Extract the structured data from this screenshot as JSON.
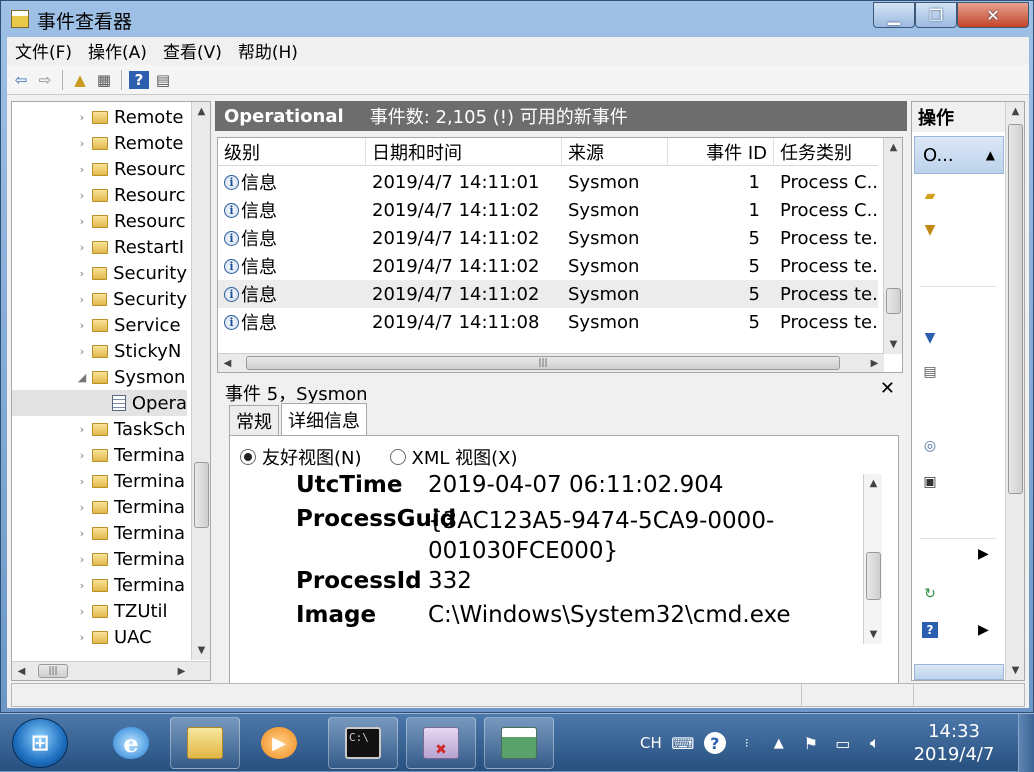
{
  "window": {
    "title": "事件查看器"
  },
  "menu": {
    "items": [
      "文件(F)",
      "操作(A)",
      "查看(V)",
      "帮助(H)"
    ]
  },
  "tree": {
    "items": [
      {
        "label": "Remote"
      },
      {
        "label": "Remote"
      },
      {
        "label": "Resourc"
      },
      {
        "label": "Resourc"
      },
      {
        "label": "Resourc"
      },
      {
        "label": "RestartI"
      },
      {
        "label": "Security"
      },
      {
        "label": "Security"
      },
      {
        "label": "Service"
      },
      {
        "label": "StickyN"
      },
      {
        "label": "Sysmon"
      },
      {
        "label": "Opera"
      },
      {
        "label": "TaskSch"
      },
      {
        "label": "Termina"
      },
      {
        "label": "Termina"
      },
      {
        "label": "Termina"
      },
      {
        "label": "Termina"
      },
      {
        "label": "Termina"
      },
      {
        "label": "Termina"
      },
      {
        "label": "TZUtil"
      },
      {
        "label": "UAC"
      }
    ]
  },
  "log": {
    "title": "Operational",
    "count_text": "事件数: 2,105 (!) 可用的新事件"
  },
  "grid": {
    "headers": [
      "级别",
      "日期和时间",
      "来源",
      "事件 ID",
      "任务类别"
    ],
    "rows": [
      {
        "level": "信息",
        "datetime": "2019/4/7 14:11:01",
        "source": "Sysmon",
        "event_id": "1",
        "task": "Process C..."
      },
      {
        "level": "信息",
        "datetime": "2019/4/7 14:11:02",
        "source": "Sysmon",
        "event_id": "1",
        "task": "Process C..."
      },
      {
        "level": "信息",
        "datetime": "2019/4/7 14:11:02",
        "source": "Sysmon",
        "event_id": "5",
        "task": "Process te..."
      },
      {
        "level": "信息",
        "datetime": "2019/4/7 14:11:02",
        "source": "Sysmon",
        "event_id": "5",
        "task": "Process te..."
      },
      {
        "level": "信息",
        "datetime": "2019/4/7 14:11:02",
        "source": "Sysmon",
        "event_id": "5",
        "task": "Process te..."
      },
      {
        "level": "信息",
        "datetime": "2019/4/7 14:11:08",
        "source": "Sysmon",
        "event_id": "5",
        "task": "Process te..."
      }
    ]
  },
  "detail": {
    "title": "事件 5，Sysmon",
    "tabs": [
      "常规",
      "详细信息"
    ],
    "radio_friendly": "友好视图(N)",
    "radio_xml": "XML 视图(X)",
    "fields": [
      {
        "key": "UtcTime",
        "value": "2019-04-07 06:11:02.904"
      },
      {
        "key": "ProcessGuid",
        "value": "{3AC123A5-9474-5CA9-0000-001030FCE000}"
      },
      {
        "key": "ProcessId",
        "value": "332"
      },
      {
        "key": "Image",
        "value": "C:\\Windows\\System32\\cmd.exe"
      }
    ]
  },
  "actions": {
    "title": "操作",
    "group_label": "O..."
  },
  "taskbar": {
    "lang": "CH",
    "time": "14:33",
    "date": "2019/4/7"
  }
}
